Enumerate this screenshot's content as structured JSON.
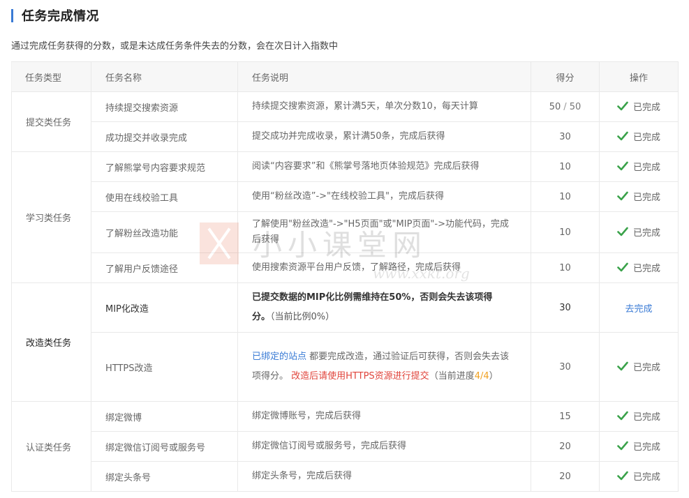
{
  "page": {
    "title": "任务完成情况",
    "description": "通过完成任务获得的分数，或是未达成任务条件失去的分数，会在次日计入指数中"
  },
  "table": {
    "headers": [
      "任务类型",
      "任务名称",
      "任务说明",
      "得分",
      "操作"
    ],
    "categories": {
      "submit": "提交类任务",
      "learn": "学习类任务",
      "reform": "改造类任务",
      "auth": "认证类任务"
    },
    "rows": [
      {
        "name": "持续提交搜索资源",
        "desc": "持续提交搜索资源，累计满5天，单次分数10，每天计算",
        "score": "50",
        "score_sep": "/",
        "score_max": "50",
        "action": "已完成"
      },
      {
        "name": "成功提交并收录完成",
        "desc": "提交成功并完成收录，累计满50条，完成后获得",
        "score": "30",
        "action": "已完成"
      },
      {
        "name": "了解熊掌号内容要求规范",
        "desc": "阅读“内容要求”和《熊掌号落地页体验规范》完成后获得",
        "score": "10",
        "action": "已完成"
      },
      {
        "name": "使用在线校验工具",
        "desc": "使用“粉丝改造”->\"在线校验工具\"，完成后获得",
        "score": "10",
        "action": "已完成"
      },
      {
        "name": "了解粉丝改造功能",
        "desc": "了解使用\"粉丝改造\"->\"H5页面\"或\"MIP页面\"->功能代码，完成后获得",
        "score": "10",
        "action": "已完成"
      },
      {
        "name": "了解用户反馈途径",
        "desc": "使用搜索资源平台用户反馈，了解路径，完成后获得",
        "score": "10",
        "action": "已完成"
      },
      {
        "name": "MIP化改造",
        "desc_main": "已提交数据的MIP化比例需维持在50%，否则会失去该项得分。",
        "desc_progress_prefix": "（当前比例",
        "desc_progress_value": "0%",
        "desc_progress_suffix": "）",
        "score": "30",
        "action": "去完成"
      },
      {
        "name": "HTTPS改造",
        "desc_link": "已绑定的站点",
        "desc_main": "都要完成改造，通过验证后可获得，否则会失去该项得分。",
        "desc_red": "改造后请使用HTTPS资源进行提交",
        "desc_progress_prefix": "（当前进度",
        "desc_progress_value": "4/4",
        "desc_progress_suffix": "）",
        "score": "30",
        "action": "已完成"
      },
      {
        "name": "绑定微博",
        "desc": "绑定微博账号，完成后获得",
        "score": "15",
        "action": "已完成"
      },
      {
        "name": "绑定微信订阅号或服务号",
        "desc": "绑定微信订阅号或服务号，完成后获得",
        "score": "20",
        "action": "已完成"
      },
      {
        "name": "绑定头条号",
        "desc": "绑定头条号，完成后获得",
        "score": "20",
        "action": "已完成"
      }
    ]
  },
  "watermark": {
    "text": "小小课堂网",
    "sub": "www.xxkt.org"
  },
  "colors": {
    "accent": "#3a7bd5",
    "score_red": "#e0443b",
    "check_green": "#3aa24a",
    "progress_orange": "#f0a020"
  }
}
